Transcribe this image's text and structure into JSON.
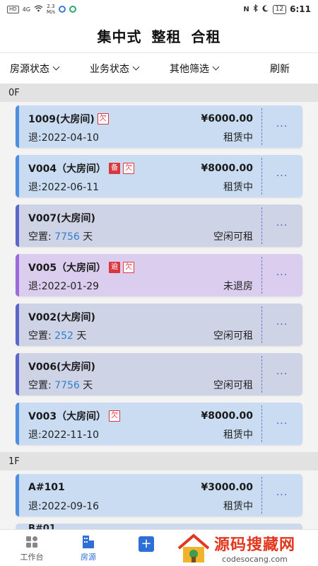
{
  "status_bar": {
    "net_badge": "HD",
    "signal": "4G",
    "speed_value": "2.3",
    "speed_unit": "M/s",
    "battery": "12",
    "time": "6:11"
  },
  "title_tabs": [
    "集中式",
    "整租",
    "合租"
  ],
  "filters": {
    "house_status": "房源状态",
    "business_status": "业务状态",
    "other_filter": "其他筛选",
    "refresh": "刷新"
  },
  "sections": [
    {
      "floor": "0F",
      "cards": [
        {
          "room": "1009(大房间)",
          "tags": [
            "欠"
          ],
          "price": "¥6000.00",
          "info_label": "退:2022-04-10",
          "days": "",
          "days_unit": "",
          "status": "租赁中",
          "kind": "rented"
        },
        {
          "room": "V004（大房间）",
          "tags": [
            "备",
            "欠"
          ],
          "price": "¥8000.00",
          "info_label": "退:2022-06-11",
          "days": "",
          "days_unit": "",
          "status": "租赁中",
          "kind": "rented"
        },
        {
          "room": "V007(大房间)",
          "tags": [],
          "price": "",
          "info_label": "空置: ",
          "days": "7756",
          "days_unit": " 天",
          "status": "空闲可租",
          "kind": "idle"
        },
        {
          "room": "V005（大房间）",
          "tags": [
            "逾",
            "欠"
          ],
          "price": "",
          "info_label": "退:2022-01-29",
          "days": "",
          "days_unit": "",
          "status": "未退房",
          "kind": "unreturned"
        },
        {
          "room": "V002(大房间)",
          "tags": [],
          "price": "",
          "info_label": "空置: ",
          "days": "252",
          "days_unit": " 天",
          "status": "空闲可租",
          "kind": "idle"
        },
        {
          "room": "V006(大房间)",
          "tags": [],
          "price": "",
          "info_label": "空置: ",
          "days": "7756",
          "days_unit": " 天",
          "status": "空闲可租",
          "kind": "idle"
        },
        {
          "room": "V003（大房间）",
          "tags": [
            "欠"
          ],
          "price": "¥8000.00",
          "info_label": "退:2022-11-10",
          "days": "",
          "days_unit": "",
          "status": "租赁中",
          "kind": "rented"
        }
      ]
    },
    {
      "floor": "1F",
      "cards": [
        {
          "room": "A#101",
          "tags": [],
          "price": "¥3000.00",
          "info_label": "退:2022-09-16",
          "days": "",
          "days_unit": "",
          "status": "租赁中",
          "kind": "rented"
        }
      ]
    }
  ],
  "more_label": "···",
  "peek_label": "B#01",
  "tabbar": {
    "workbench": "工作台",
    "listings": "房源",
    "add": "+"
  },
  "watermark": {
    "title": "源码搜藏网",
    "url": "codesocang.com"
  },
  "colors": {
    "rented_bg": "#c9dcf1",
    "idle_bg": "#cfd3e6",
    "unreturned_bg": "#dbcdee",
    "accent": "#2d6fd6",
    "tag_red": "#d9363e"
  }
}
